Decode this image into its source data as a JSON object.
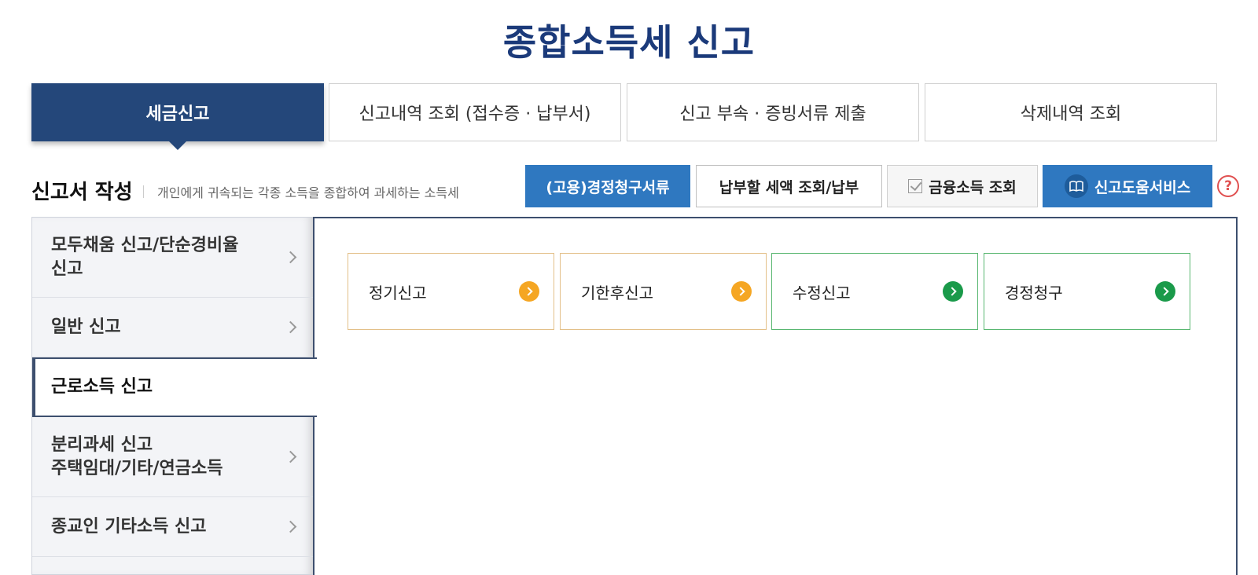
{
  "page_title": "종합소득세 신고",
  "tabs": [
    {
      "label": "세금신고",
      "active": true
    },
    {
      "label": "신고내역 조회 (접수증 · 납부서)",
      "active": false
    },
    {
      "label": "신고 부속 · 증빙서류 제출",
      "active": false
    },
    {
      "label": "삭제내역 조회",
      "active": false
    }
  ],
  "section": {
    "title": "신고서 작성",
    "description": "개인에게 귀속되는 각종 소득을 종합하여 과세하는 소득세"
  },
  "toolbar": {
    "claim_docs": "(고용)경정청구서류",
    "tax_payment": "납부할 세액 조회/납부",
    "financial_income": "금융소득 조회",
    "help_service": "신고도움서비스",
    "help_icon": "?"
  },
  "sidebar": {
    "items": [
      {
        "label": "모두채움 신고/단순경비율\n신고"
      },
      {
        "label": "일반 신고"
      },
      {
        "label": "근로소득 신고"
      },
      {
        "label": "분리과세 신고\n주택임대/기타/연금소득"
      },
      {
        "label": "종교인 기타소득 신고"
      }
    ]
  },
  "cards": [
    {
      "label": "정기신고",
      "color": "orange"
    },
    {
      "label": "기한후신고",
      "color": "orange"
    },
    {
      "label": "수정신고",
      "color": "green"
    },
    {
      "label": "경정청구",
      "color": "green"
    }
  ],
  "colors": {
    "primary_navy": "#24477a",
    "button_blue": "#2f78c0",
    "title_blue": "#1b3a7a",
    "orange": "#f5a623",
    "green": "#1a9a4a"
  }
}
